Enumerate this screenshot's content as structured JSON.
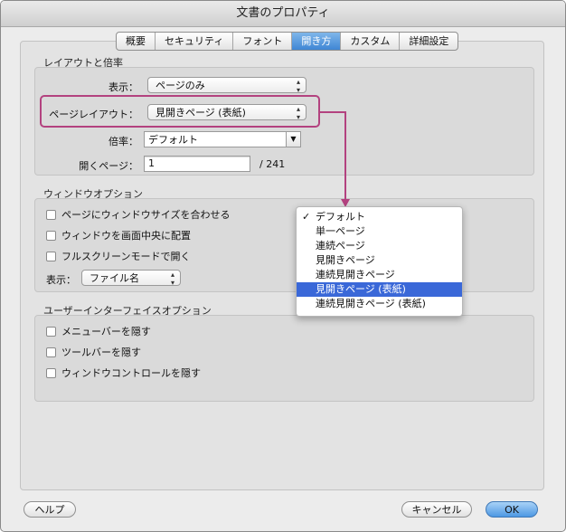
{
  "window": {
    "title": "文書のプロパティ"
  },
  "tabs": [
    {
      "label": "概要",
      "active": false
    },
    {
      "label": "セキュリティ",
      "active": false
    },
    {
      "label": "フォント",
      "active": false
    },
    {
      "label": "開き方",
      "active": true
    },
    {
      "label": "カスタム",
      "active": false
    },
    {
      "label": "詳細設定",
      "active": false
    }
  ],
  "layout_section": {
    "title": "レイアウトと倍率",
    "display_label": "表示：",
    "display_value": "ページのみ",
    "page_layout_label": "ページレイアウト：",
    "page_layout_value": "見開きページ (表紙)",
    "zoom_label": "倍率：",
    "zoom_value": "デフォルト",
    "open_page_label": "開くページ：",
    "open_page_value": "1",
    "page_total": "/ 241"
  },
  "window_section": {
    "title": "ウィンドウオプション",
    "options": [
      "ページにウィンドウサイズを合わせる",
      "ウィンドウを画面中央に配置",
      "フルスクリーンモードで開く"
    ],
    "show_label": "表示：",
    "show_value": "ファイル名"
  },
  "ui_section": {
    "title": "ユーザーインターフェイスオプション",
    "options": [
      "メニューバーを隠す",
      "ツールバーを隠す",
      "ウィンドウコントロールを隠す"
    ]
  },
  "dropdown_menu": {
    "items": [
      {
        "label": "デフォルト",
        "checked": true,
        "selected": false
      },
      {
        "label": "単一ページ",
        "checked": false,
        "selected": false
      },
      {
        "label": "連続ページ",
        "checked": false,
        "selected": false
      },
      {
        "label": "見開きページ",
        "checked": false,
        "selected": false
      },
      {
        "label": "連続見開きページ",
        "checked": false,
        "selected": false
      },
      {
        "label": "見開きページ (表紙)",
        "checked": false,
        "selected": true
      },
      {
        "label": "連続見開きページ (表紙)",
        "checked": false,
        "selected": false
      }
    ],
    "check_glyph": "✓"
  },
  "buttons": {
    "help": "ヘルプ",
    "cancel": "キャンセル",
    "ok": "OK"
  },
  "colors": {
    "highlight": "#b3427f",
    "selection": "#3a68d8",
    "active_tab": "#3f86d4"
  }
}
